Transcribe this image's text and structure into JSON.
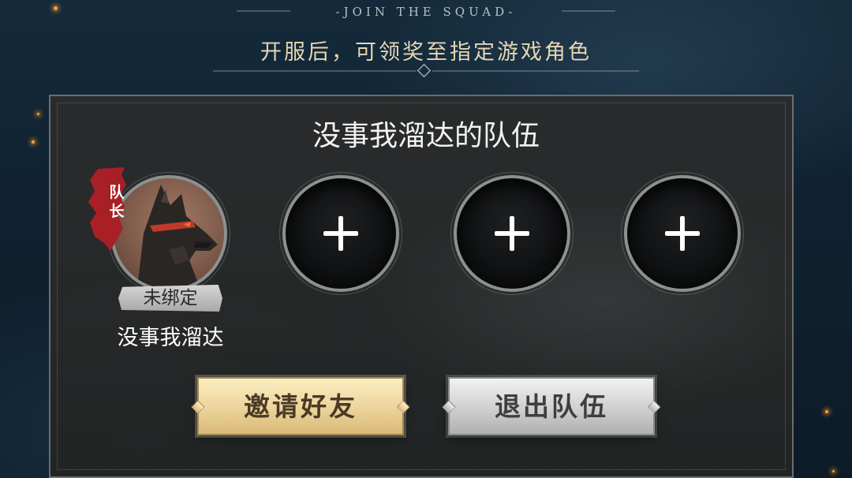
{
  "header": {
    "tagline": "-JOIN THE SQUAD-",
    "subtitle": "开服后，可领奖至指定游戏角色"
  },
  "team": {
    "name": "没事我溜达的队伍",
    "leader": {
      "badge": "队长",
      "bind_status": "未绑定",
      "player_name": "没事我溜达",
      "avatar_icon": "wolf-portrait"
    },
    "empty_slots": [
      {
        "icon": "plus-icon"
      },
      {
        "icon": "plus-icon"
      },
      {
        "icon": "plus-icon"
      }
    ]
  },
  "actions": {
    "invite_label": "邀请好友",
    "leave_label": "退出队伍"
  },
  "colors": {
    "background": "#102232",
    "panel": "#2a2c2c",
    "gold_button": "#ecd39a",
    "silver_button": "#cfcfcf",
    "leader_badge": "#b0202a",
    "subtitle_text": "#e6d6b4"
  }
}
